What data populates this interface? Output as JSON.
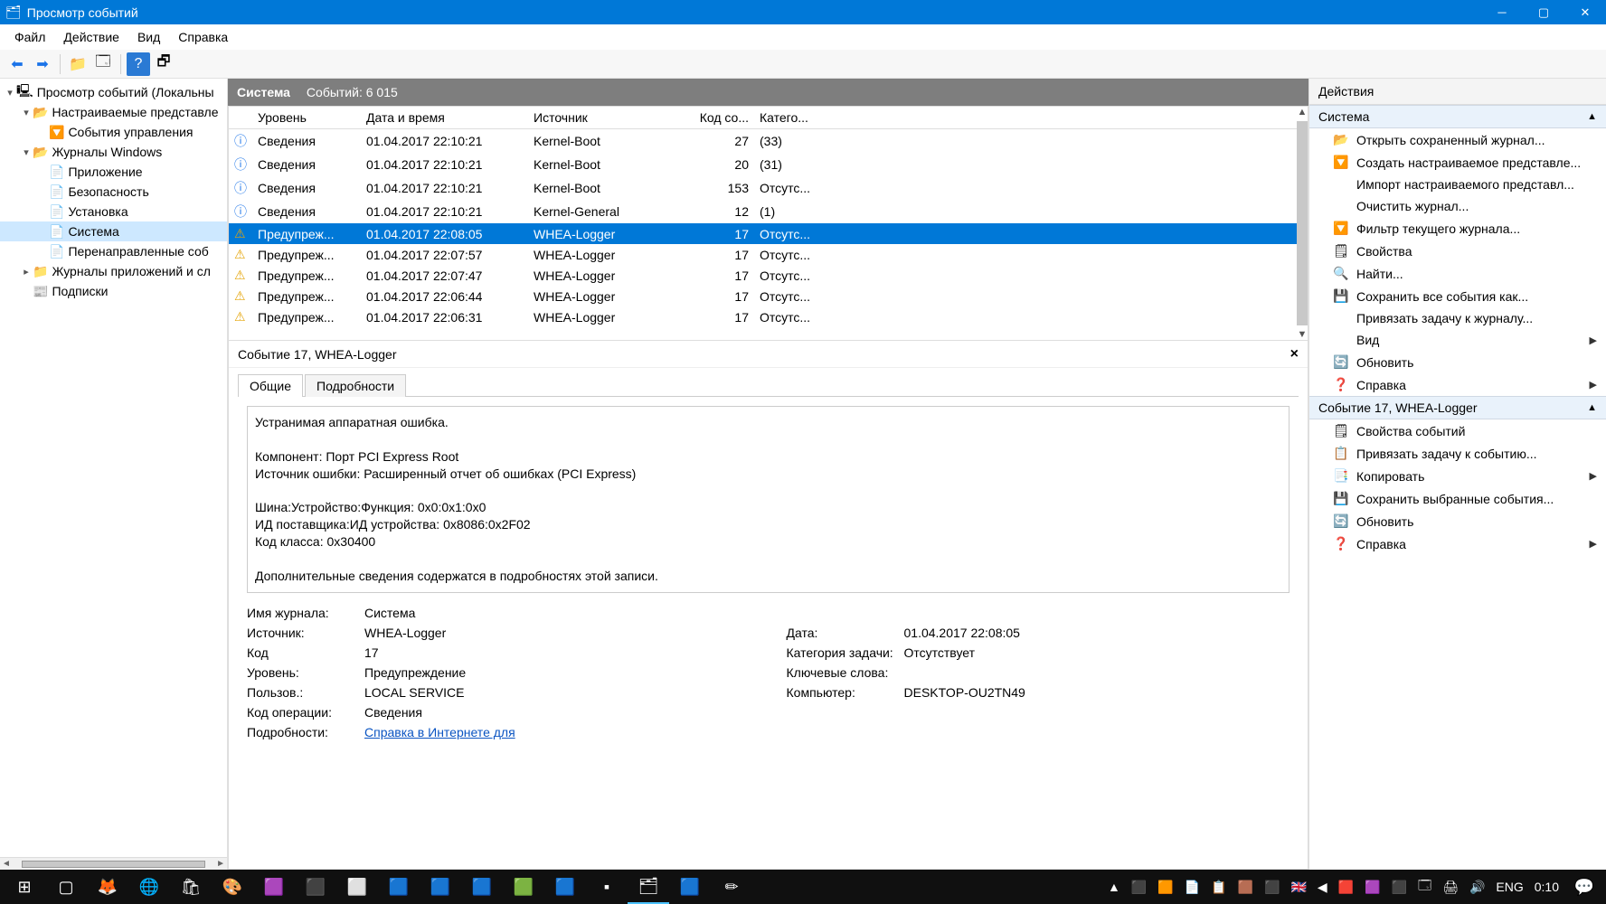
{
  "window": {
    "title": "Просмотр событий"
  },
  "menu": {
    "items": [
      "Файл",
      "Действие",
      "Вид",
      "Справка"
    ]
  },
  "toolbar": {
    "items": [
      "←",
      "→",
      "|",
      "📁",
      "🗔",
      "|",
      "❓",
      "🗗"
    ]
  },
  "tree": {
    "root": {
      "label": "Просмотр событий (Локальны",
      "icon": "🖳",
      "twisty": "▾",
      "indent": 0
    },
    "fold1": {
      "label": "Настраиваемые представле",
      "icon": "📂",
      "twisty": "▾",
      "indent": 1
    },
    "leaf1": {
      "label": "События управления",
      "icon": "🔽",
      "twisty": "",
      "indent": 2
    },
    "fold2": {
      "label": "Журналы Windows",
      "icon": "📂",
      "twisty": "▾",
      "indent": 1
    },
    "leaf2a": {
      "label": "Приложение",
      "icon": "📄",
      "twisty": "",
      "indent": 2
    },
    "leaf2b": {
      "label": "Безопасность",
      "icon": "📄",
      "twisty": "",
      "indent": 2
    },
    "leaf2c": {
      "label": "Установка",
      "icon": "📄",
      "twisty": "",
      "indent": 2
    },
    "leaf2d": {
      "label": "Система",
      "icon": "📄",
      "twisty": "",
      "indent": 2,
      "selected": true
    },
    "leaf2e": {
      "label": "Перенаправленные соб",
      "icon": "📄",
      "twisty": "",
      "indent": 2
    },
    "fold3": {
      "label": "Журналы приложений и сл",
      "icon": "📁",
      "twisty": "▸",
      "indent": 1
    },
    "leaf4": {
      "label": "Подписки",
      "icon": "📰",
      "twisty": "",
      "indent": 1
    }
  },
  "center": {
    "title": "Система",
    "count_label": "Событий: 6 015",
    "columns": {
      "level": "Уровень",
      "date": "Дата и время",
      "source": "Источник",
      "code": "Код со...",
      "cat": "Катего..."
    },
    "rows": [
      {
        "icon": "info",
        "level": "Сведения",
        "date": "01.04.2017 22:10:21",
        "source": "Kernel-Boot",
        "code": "27",
        "cat": "(33)"
      },
      {
        "icon": "info",
        "level": "Сведения",
        "date": "01.04.2017 22:10:21",
        "source": "Kernel-Boot",
        "code": "20",
        "cat": "(31)"
      },
      {
        "icon": "info",
        "level": "Сведения",
        "date": "01.04.2017 22:10:21",
        "source": "Kernel-Boot",
        "code": "153",
        "cat": "Отсутс..."
      },
      {
        "icon": "info",
        "level": "Сведения",
        "date": "01.04.2017 22:10:21",
        "source": "Kernel-General",
        "code": "12",
        "cat": "(1)"
      },
      {
        "icon": "warn",
        "level": "Предупреж...",
        "date": "01.04.2017 22:08:05",
        "source": "WHEA-Logger",
        "code": "17",
        "cat": "Отсутс...",
        "selected": true
      },
      {
        "icon": "warn",
        "level": "Предупреж...",
        "date": "01.04.2017 22:07:57",
        "source": "WHEA-Logger",
        "code": "17",
        "cat": "Отсутс..."
      },
      {
        "icon": "warn",
        "level": "Предупреж...",
        "date": "01.04.2017 22:07:47",
        "source": "WHEA-Logger",
        "code": "17",
        "cat": "Отсутс..."
      },
      {
        "icon": "warn",
        "level": "Предупреж...",
        "date": "01.04.2017 22:06:44",
        "source": "WHEA-Logger",
        "code": "17",
        "cat": "Отсутс..."
      },
      {
        "icon": "warn",
        "level": "Предупреж...",
        "date": "01.04.2017 22:06:31",
        "source": "WHEA-Logger",
        "code": "17",
        "cat": "Отсутс..."
      }
    ]
  },
  "detail": {
    "header": "Событие 17, WHEA-Logger",
    "tabs": {
      "general": "Общие",
      "details": "Подробности"
    },
    "message": {
      "l1": "Устранимая аппаратная ошибка.",
      "l2": "Компонент: Порт PCI Express Root",
      "l3": "Источник ошибки: Расширенный отчет об ошибках (PCI Express)",
      "l4": "Шина:Устройство:Функция: 0x0:0x1:0x0",
      "l5": "ИД поставщика:ИД устройства: 0x8086:0x2F02",
      "l6": "Код класса: 0x30400",
      "l7": "Дополнительные сведения содержатся в подробностях этой записи."
    },
    "labels": {
      "log": "Имя журнала:",
      "source": "Источник:",
      "id": "Код",
      "level": "Уровень:",
      "user": "Пользов.:",
      "opcode": "Код операции:",
      "info": "Подробности:",
      "date": "Дата:",
      "task": "Категория задачи:",
      "keywords": "Ключевые слова:",
      "computer": "Компьютер:"
    },
    "values": {
      "log": "Система",
      "source": "WHEA-Logger",
      "id": "17",
      "level": "Предупреждение",
      "user": "LOCAL SERVICE",
      "opcode": "Сведения",
      "info_link": "Справка в Интернете для ",
      "date": "01.04.2017 22:08:05",
      "task": "Отсутствует",
      "keywords": "",
      "computer": "DESKTOP-OU2TN49"
    }
  },
  "actions": {
    "header": "Действия",
    "sec1": "Система",
    "sec2": "Событие 17, WHEA-Logger",
    "a": {
      "open": "Открыть сохраненный журнал...",
      "create": "Создать настраиваемое представле...",
      "import": "Импорт настраиваемого представл...",
      "clear": "Очистить журнал...",
      "filter": "Фильтр текущего журнала...",
      "props": "Свойства",
      "find": "Найти...",
      "saveall": "Сохранить все события как...",
      "attach": "Привязать задачу к журналу...",
      "view": "Вид",
      "refresh": "Обновить",
      "help": "Справка",
      "evprops": "Свойства событий",
      "evattach": "Привязать задачу к событию...",
      "copy": "Копировать",
      "savesel": "Сохранить выбранные события...",
      "refresh2": "Обновить",
      "help2": "Справка"
    }
  },
  "taskbar": {
    "lang": "ENG",
    "time": "0:10"
  }
}
